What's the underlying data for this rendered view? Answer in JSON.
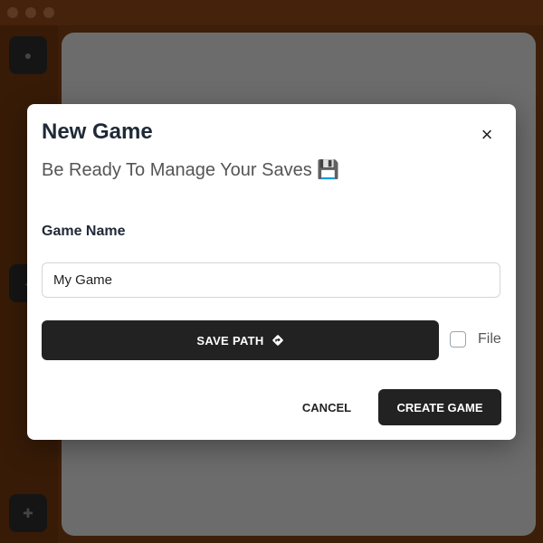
{
  "window": {
    "background_color": "#7a3c12"
  },
  "sidebar": {
    "items": [
      {
        "icon": "home-icon"
      },
      {
        "icon": "arrow-icon"
      },
      {
        "icon": "settings-icon"
      }
    ]
  },
  "dialog": {
    "title": "New Game",
    "subtitle": "Be Ready To Manage Your Saves 💾",
    "close_icon": "×",
    "game_name_label": "Game Name",
    "game_name_value": "My Game",
    "save_path_label": "SAVE PATH",
    "file_checkbox_label": "File",
    "file_checked": false,
    "cancel_label": "CANCEL",
    "create_label": "CREATE GAME",
    "primary_button_color": "#222222"
  }
}
